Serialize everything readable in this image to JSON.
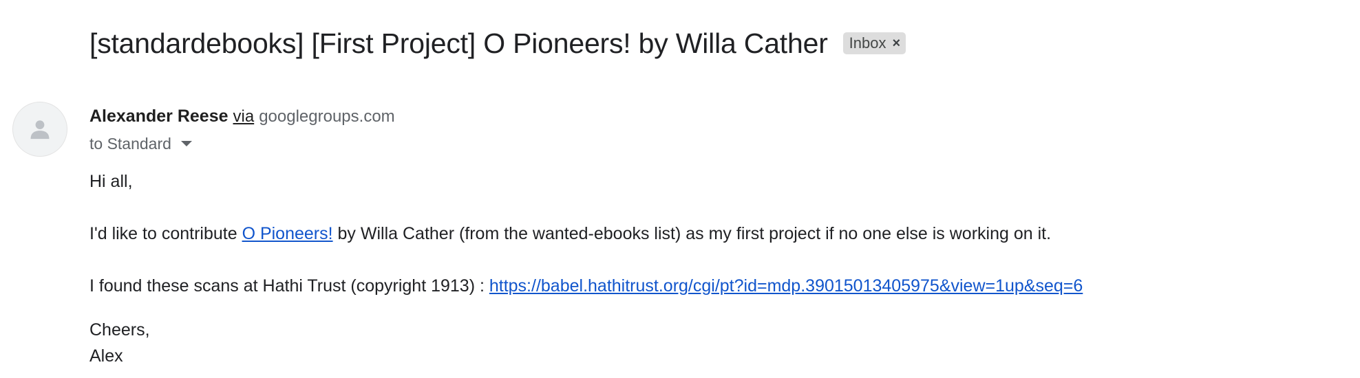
{
  "email": {
    "subject": "[standardebooks] [First Project] O Pioneers! by Willa Cather",
    "label": "Inbox",
    "label_close": "×",
    "sender": {
      "name": "Alexander Reese",
      "via": "via",
      "via_domain": "googlegroups.com"
    },
    "recipient": "to Standard",
    "body": {
      "greeting": "Hi all,",
      "contrib_before": "I'd like to contribute ",
      "contrib_link": "O Pioneers!",
      "contrib_after": " by Willa Cather (from the wanted-ebooks list) as my first project if no one else is working on it.",
      "scans_before": "I found these scans at Hathi Trust (copyright 1913) : ",
      "scans_link": "https://babel.hathitrust.org/cgi/pt?id=mdp.39015013405975&view=1up&seq=6",
      "signoff": "Cheers,",
      "signature": "Alex"
    }
  },
  "icons": {
    "avatar": "person-icon",
    "label_close": "close-icon",
    "recipient_expand": "caret-down-icon"
  },
  "colors": {
    "link": "#1155cc",
    "label_chip": "#dddddd",
    "secondary_text": "#5f6368"
  }
}
